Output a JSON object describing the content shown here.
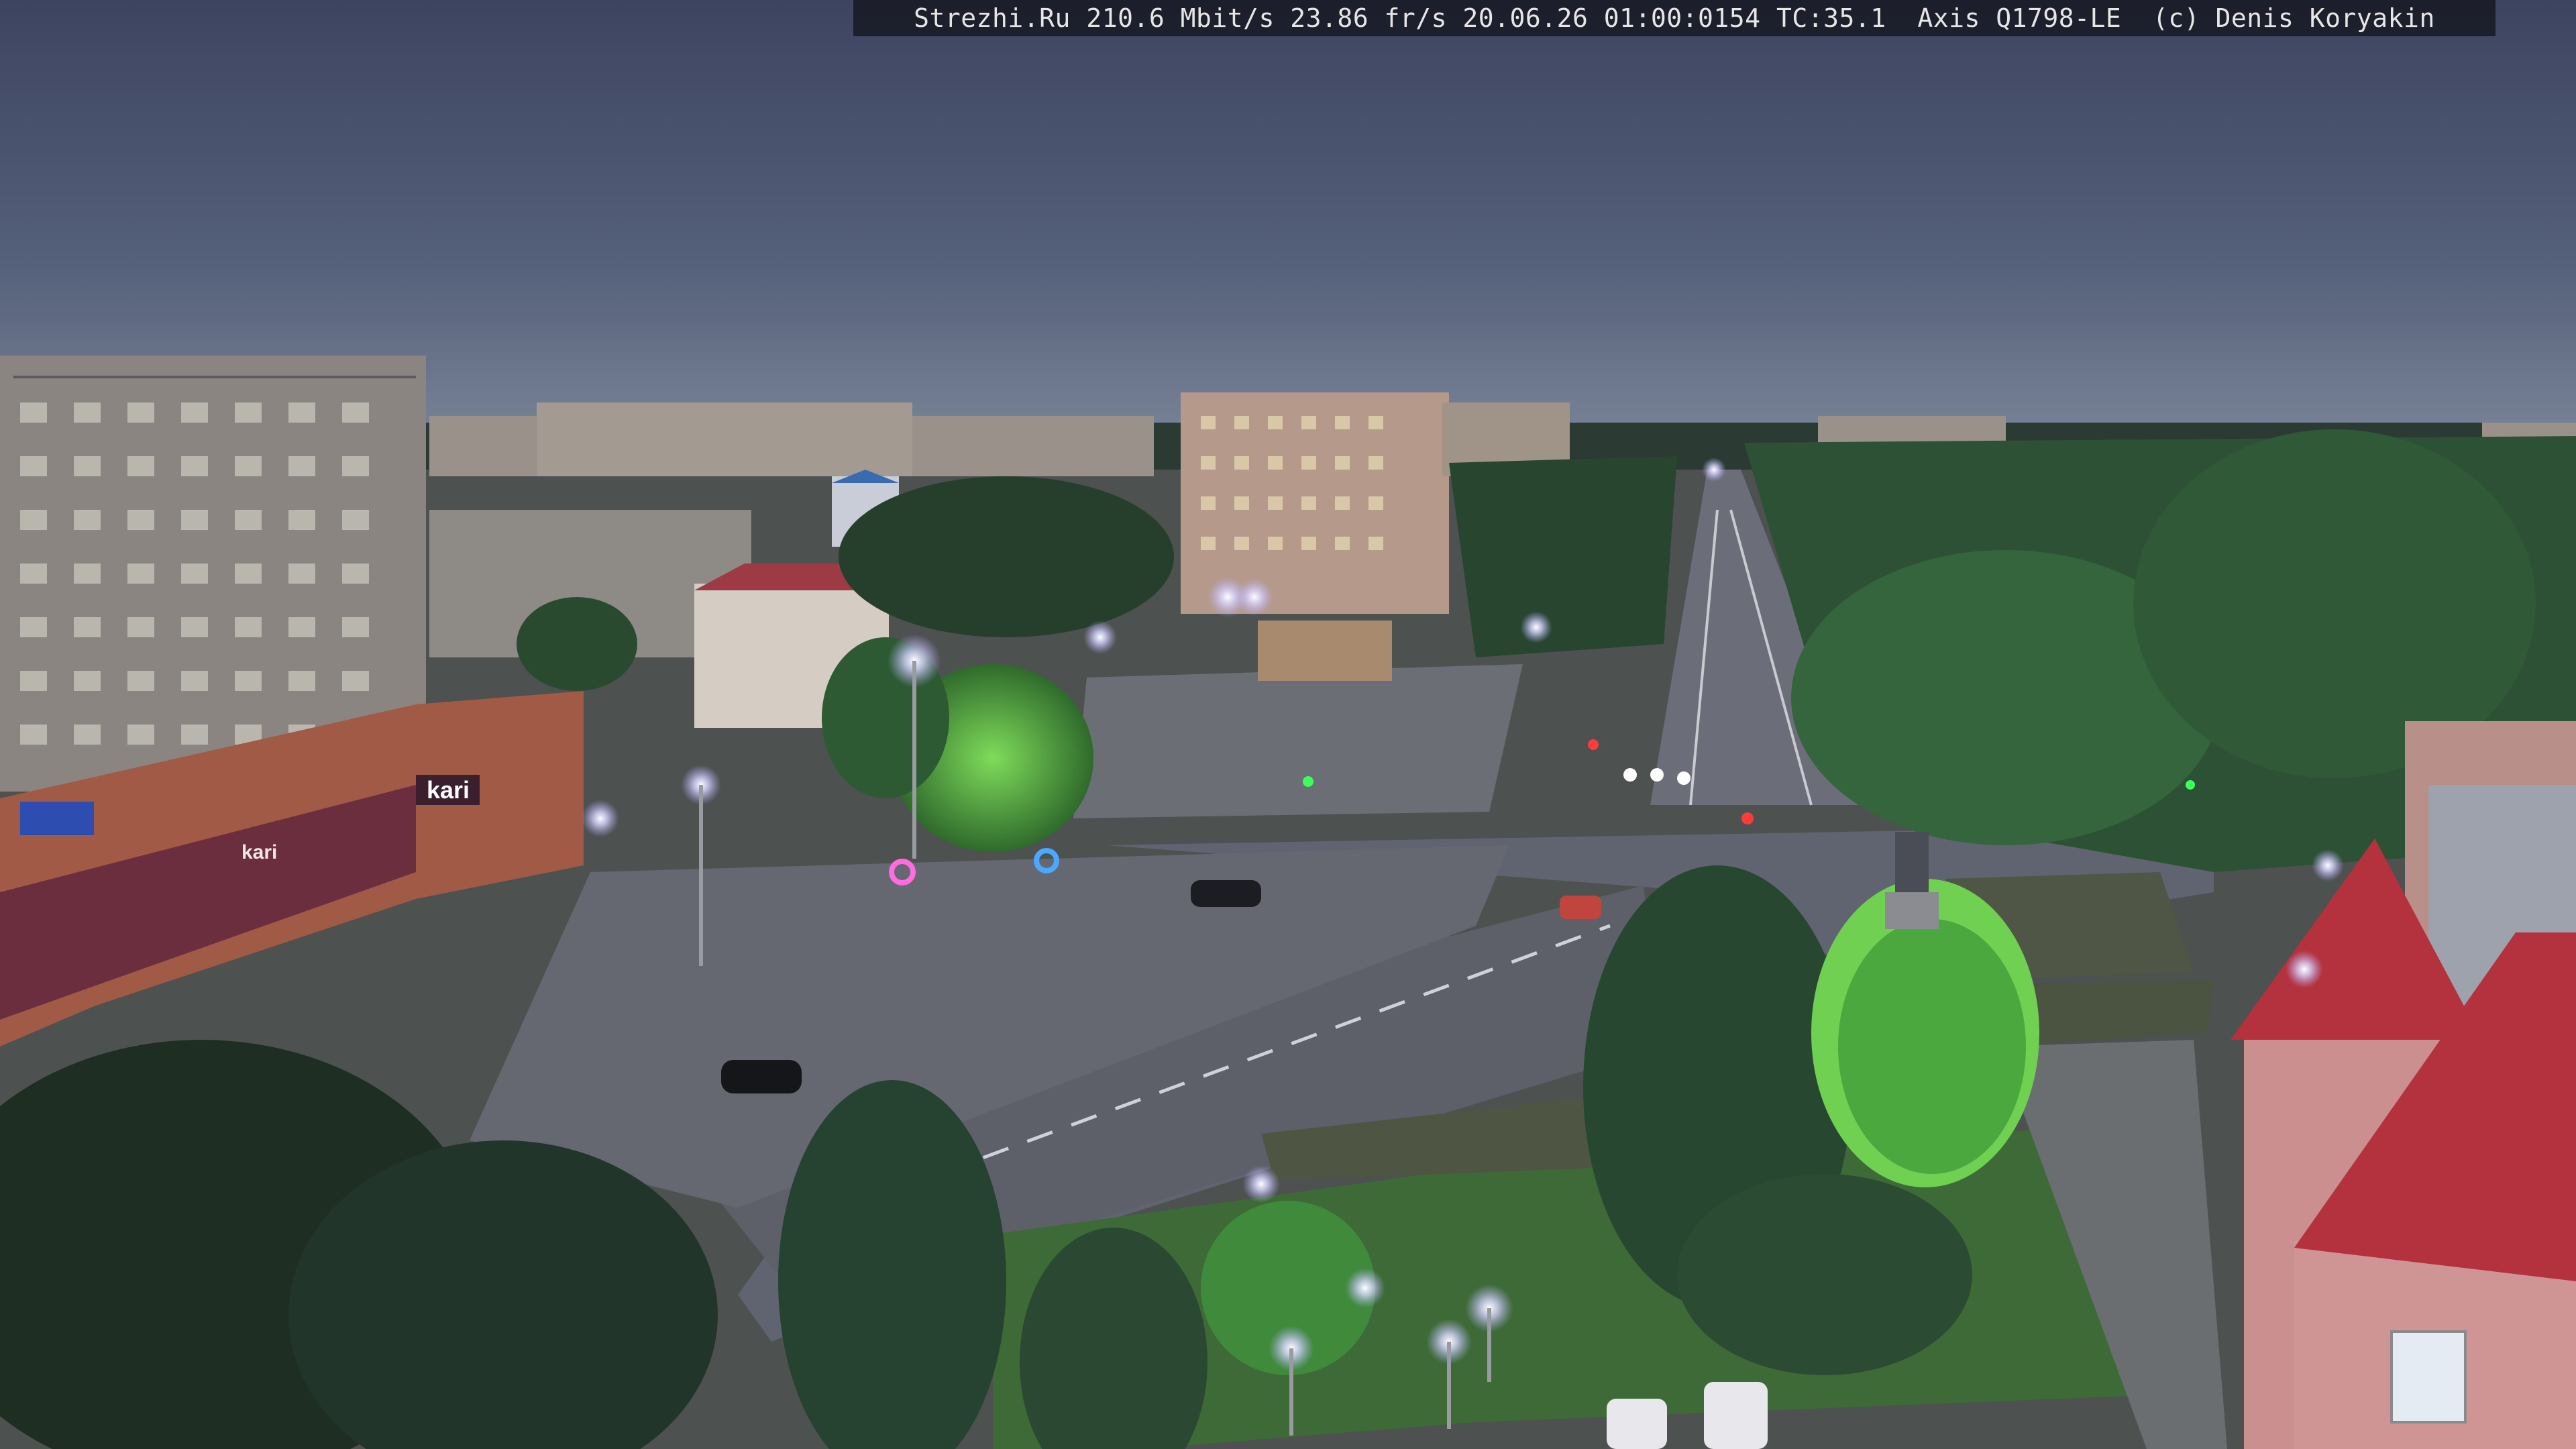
{
  "camera_overlay": {
    "text": "Strezhi.Ru 210.6 Mbit/s 23.86 fr/s 20.06.26 01:00:0154 TC:35.1  Axis Q1798-LE  (c) Denis Koryakin"
  },
  "signs": {
    "store_kari": "kari",
    "store_kari_small": "kari"
  },
  "colors": {
    "sky_top": "#3f4660",
    "sky_horizon": "#6f7890",
    "road": "#5f626c",
    "street_light": "#e6e2ff",
    "red_roof": "#b3323d"
  }
}
